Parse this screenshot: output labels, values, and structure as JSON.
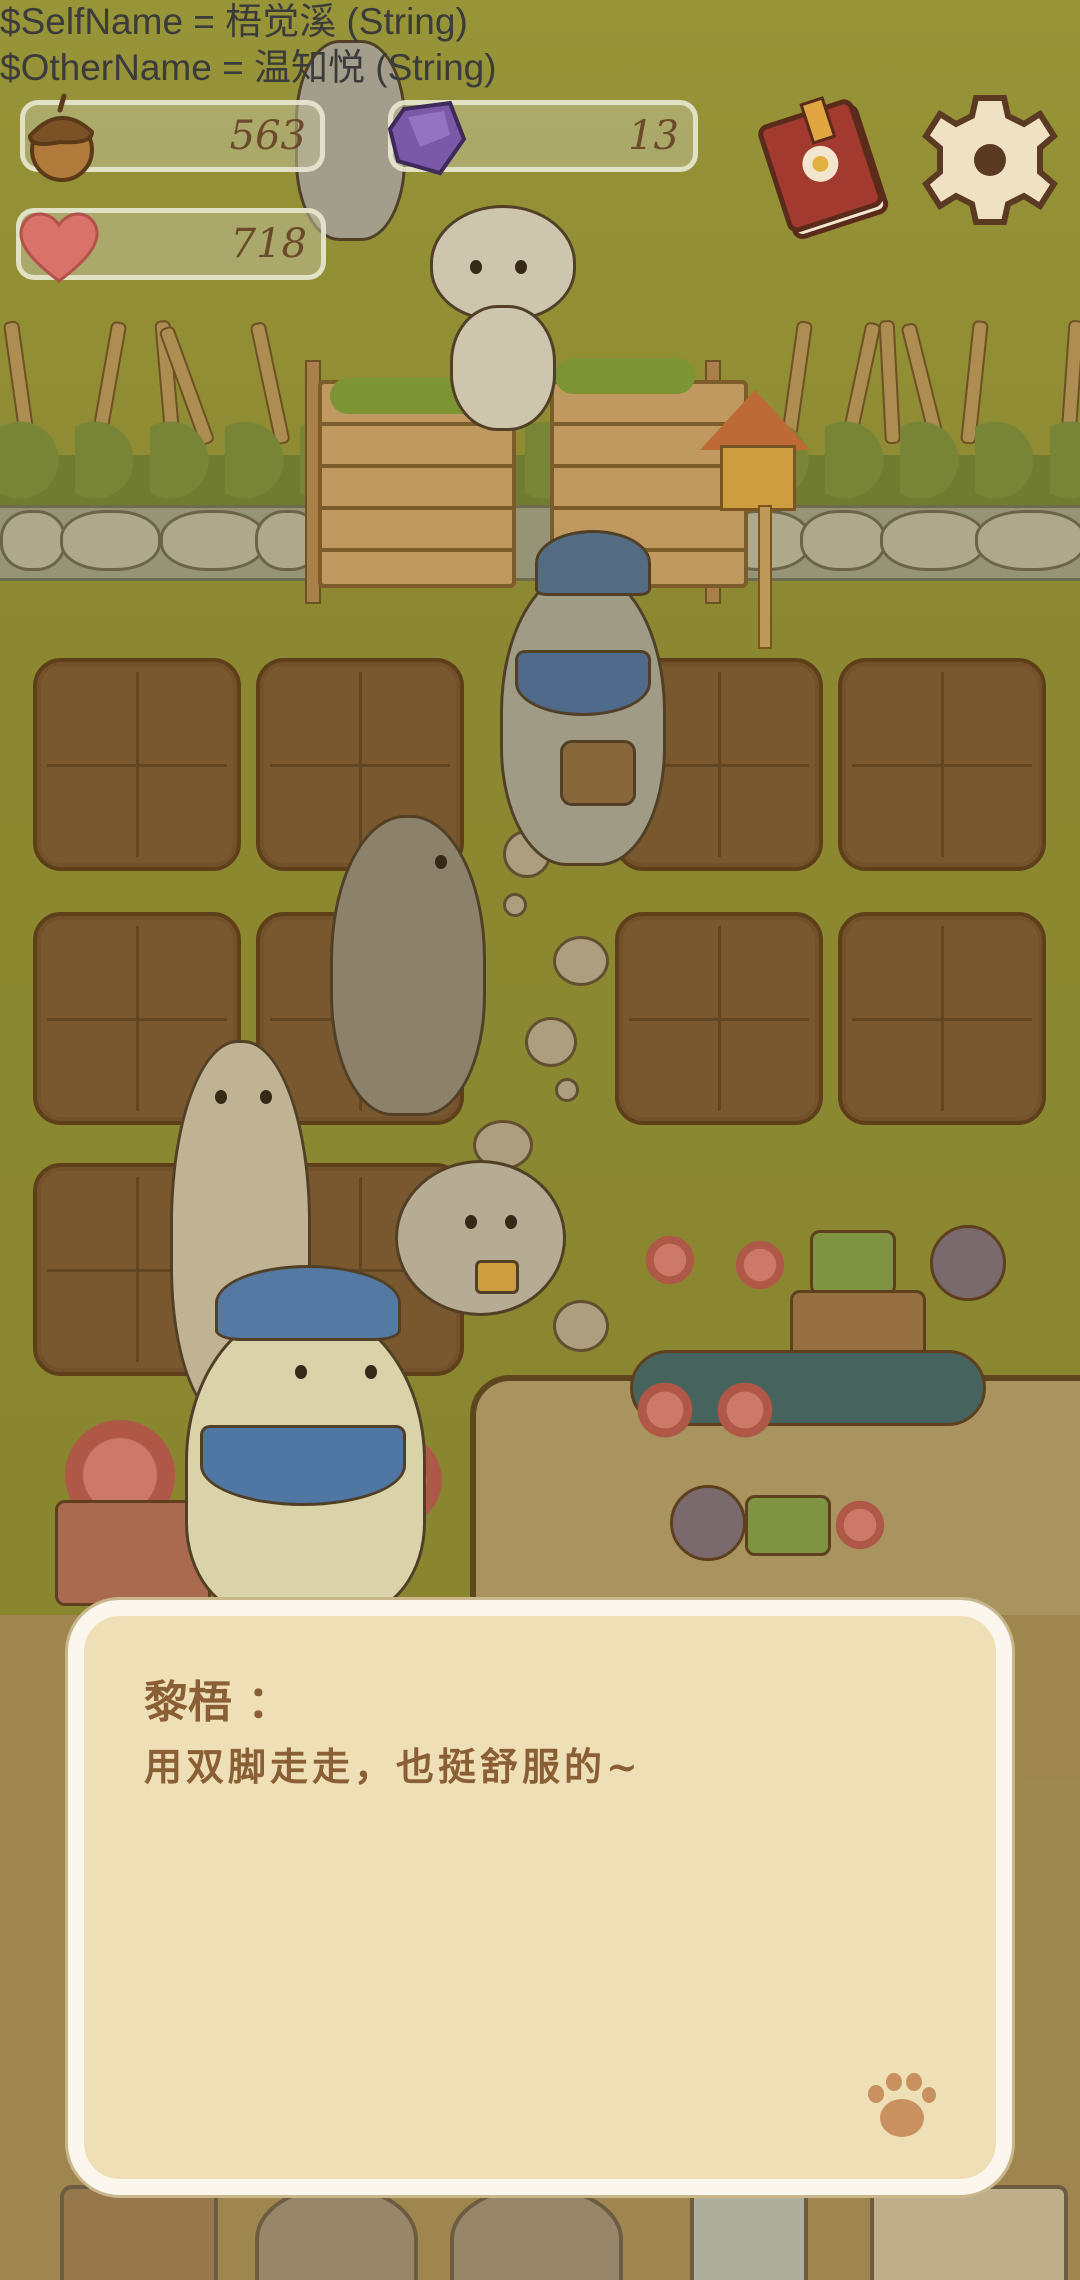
{
  "debug": {
    "self_name_line": "$SelfName = 梧觉溪 (String)",
    "other_name_line": "$OtherName = 温知悦 (String)"
  },
  "hud": {
    "acorns": {
      "icon": "acorn-icon",
      "value": "563"
    },
    "gems": {
      "icon": "purple-gem-icon",
      "value": "13"
    },
    "hearts": {
      "icon": "heart-icon",
      "value": "718"
    },
    "journal_button": {
      "icon": "book-icon"
    },
    "settings_button": {
      "icon": "gear-icon"
    }
  },
  "dialog": {
    "speaker": "黎梧 ：",
    "text": "用双脚走走，也挺舒服的~",
    "advance_icon": "paw-icon"
  },
  "bottom_nav": {
    "items": [
      "gate-icon",
      "character-avatar-1",
      "character-avatar-2",
      "book-icon",
      "map-icon"
    ]
  },
  "colors": {
    "dialog_bg": "#efdfb6",
    "dialog_border": "#fbf7ee",
    "text_brown": "#8a5f36",
    "grass": "#8f8d36",
    "soil": "#7a5634"
  }
}
